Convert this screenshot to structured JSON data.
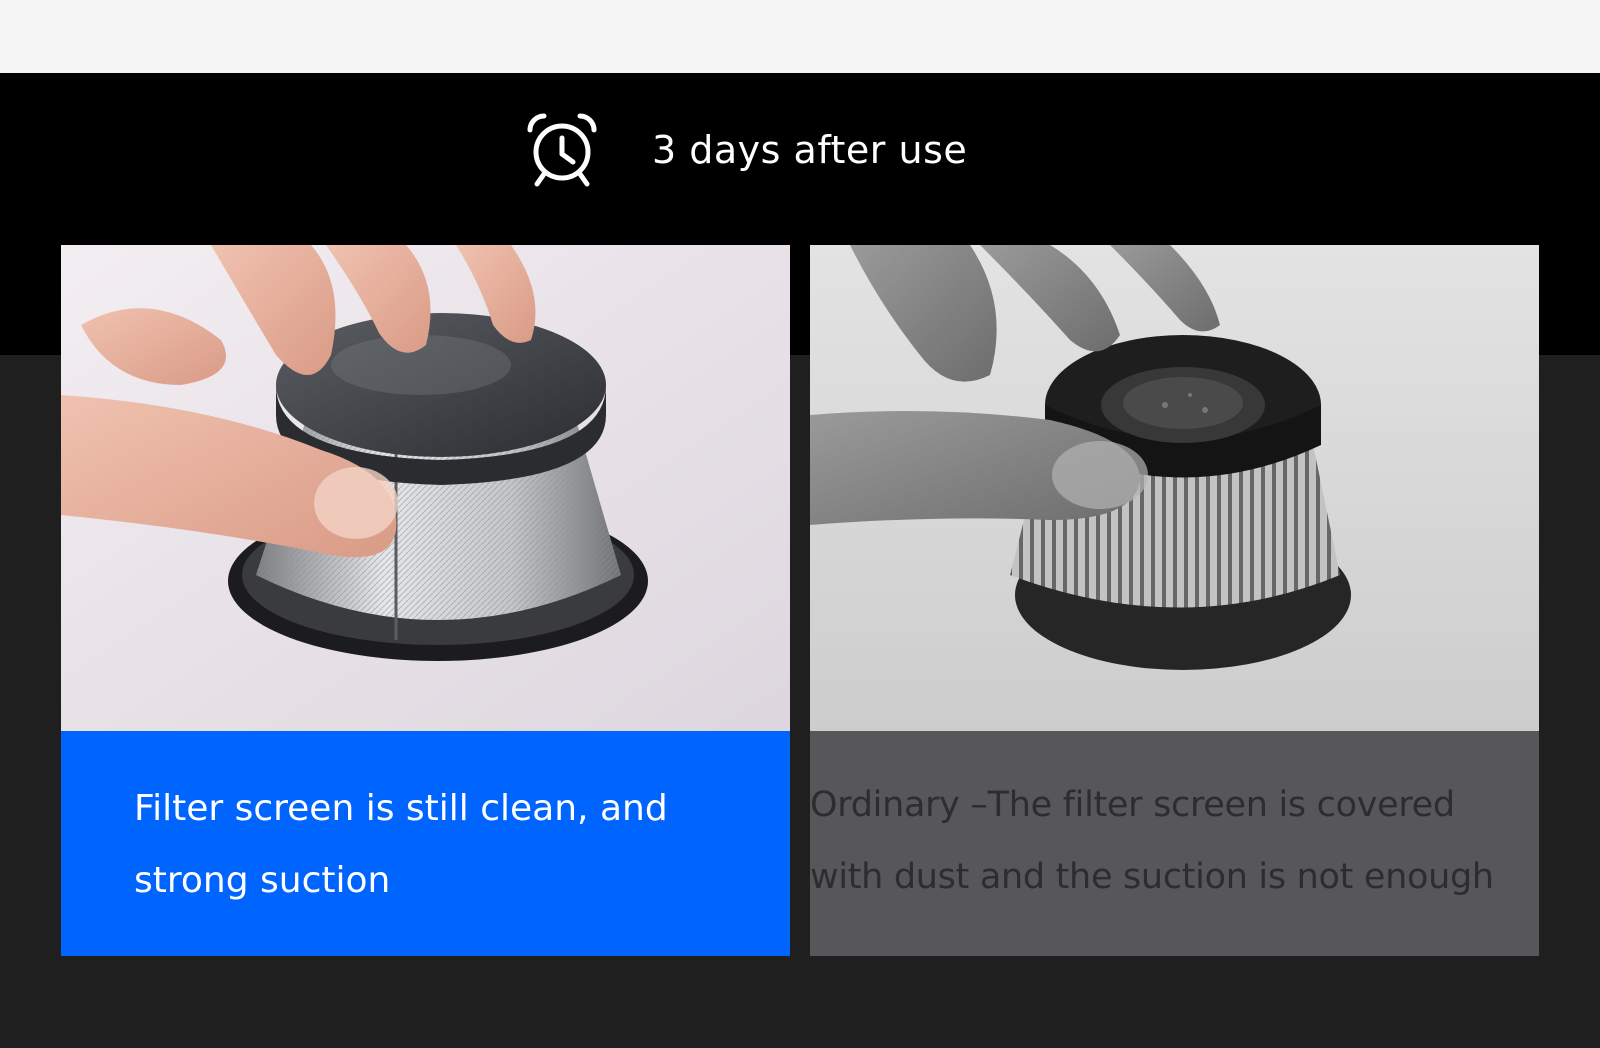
{
  "header": {
    "icon": "alarm-clock-icon",
    "title": "3 days after use"
  },
  "cards": [
    {
      "image": "clean-filter-photo",
      "caption_line1": "Filter screen is still clean, and",
      "caption_line2": "strong suction",
      "caption_bg": "#0064ff"
    },
    {
      "image": "dirty-filter-photo",
      "caption_line1": "Ordinary –The filter screen is covered",
      "caption_line2": "with dust and the suction is not enough",
      "caption_bg": "#575759"
    }
  ],
  "colors": {
    "top_strip": "#f5f5f5",
    "header_band": "#000000",
    "page_bg": "#1f1f1f",
    "accent_blue": "#0064ff"
  }
}
